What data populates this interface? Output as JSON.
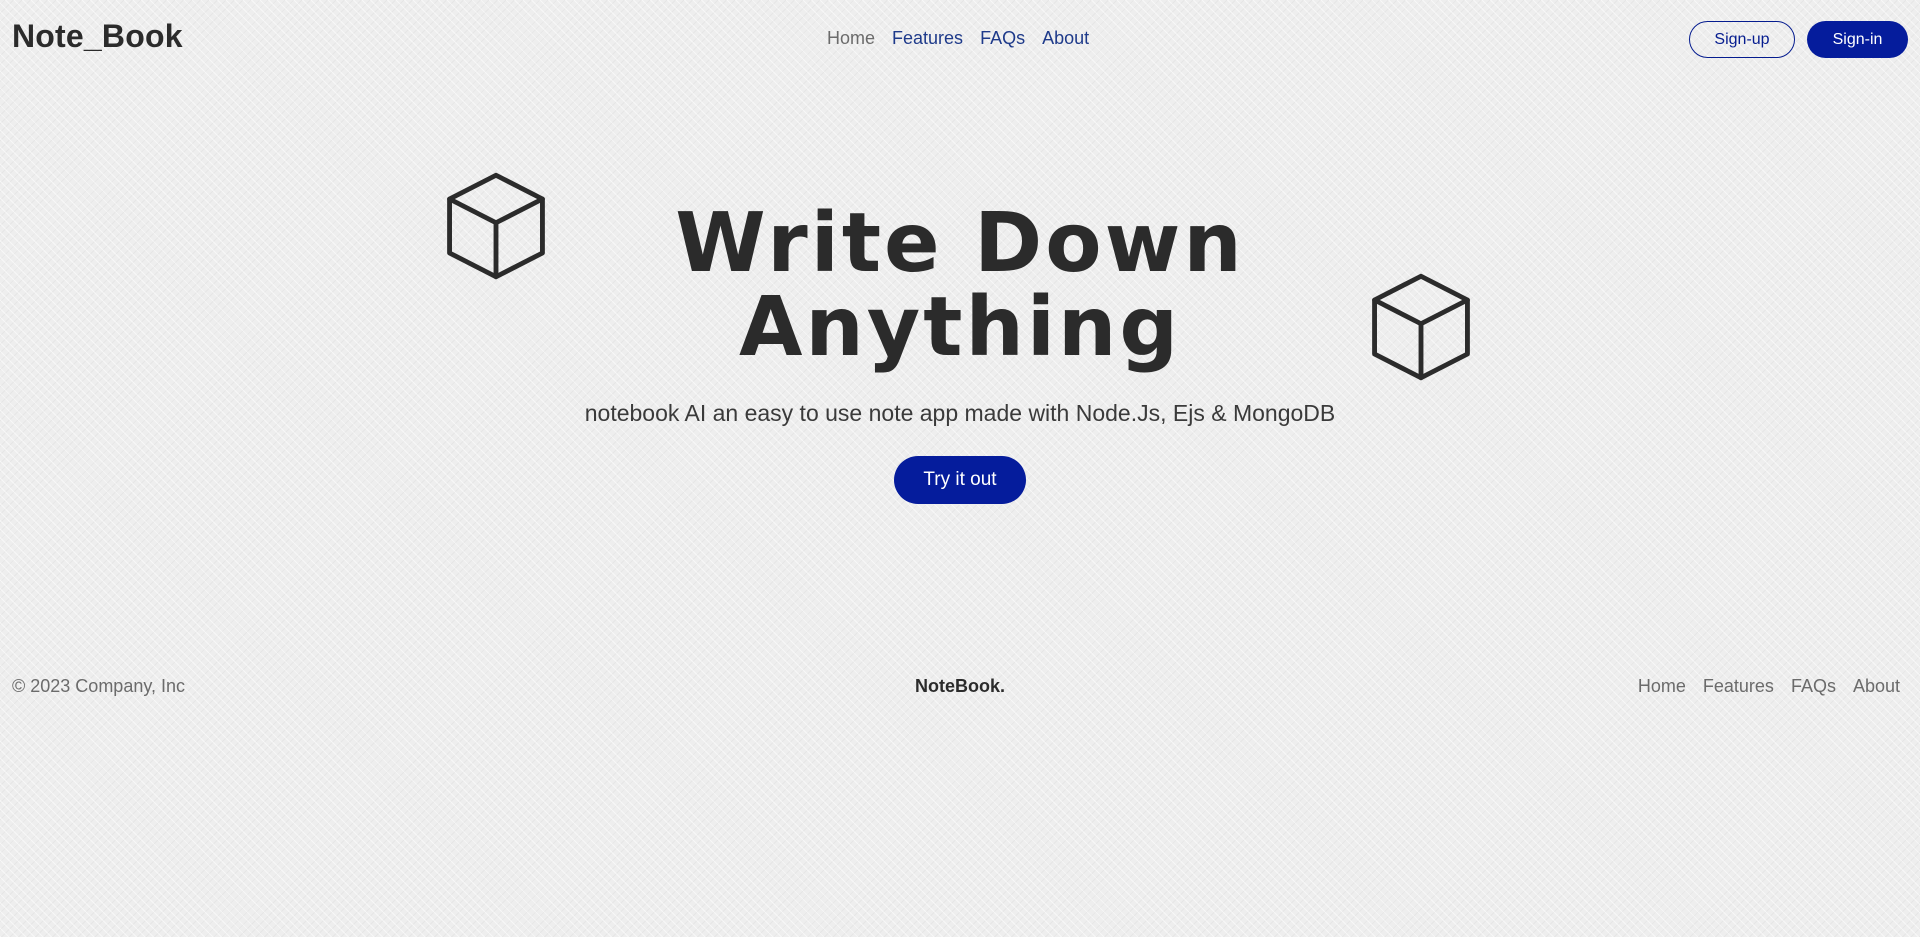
{
  "header": {
    "logo": "Note_Book",
    "nav": [
      {
        "label": "Home"
      },
      {
        "label": "Features"
      },
      {
        "label": "FAQs"
      },
      {
        "label": "About"
      }
    ],
    "signup_label": "Sign-up",
    "signin_label": "Sign-in"
  },
  "hero": {
    "title_line1": "Write Down",
    "title_line2": "Anything",
    "subtitle": "notebook AI an easy to use note app made with Node.Js, Ejs & MongoDB",
    "cta_label": "Try it out",
    "icons": [
      "cube-icon",
      "cube-icon"
    ]
  },
  "footer": {
    "copyright": "© 2023 Company, Inc",
    "brand": "NoteBook.",
    "nav": [
      {
        "label": "Home"
      },
      {
        "label": "Features"
      },
      {
        "label": "FAQs"
      },
      {
        "label": "About"
      }
    ]
  },
  "colors": {
    "accent": "#051c9c",
    "nav_link": "#1e3a8a",
    "text": "#2b2b2b",
    "muted": "#6b6b6b"
  }
}
